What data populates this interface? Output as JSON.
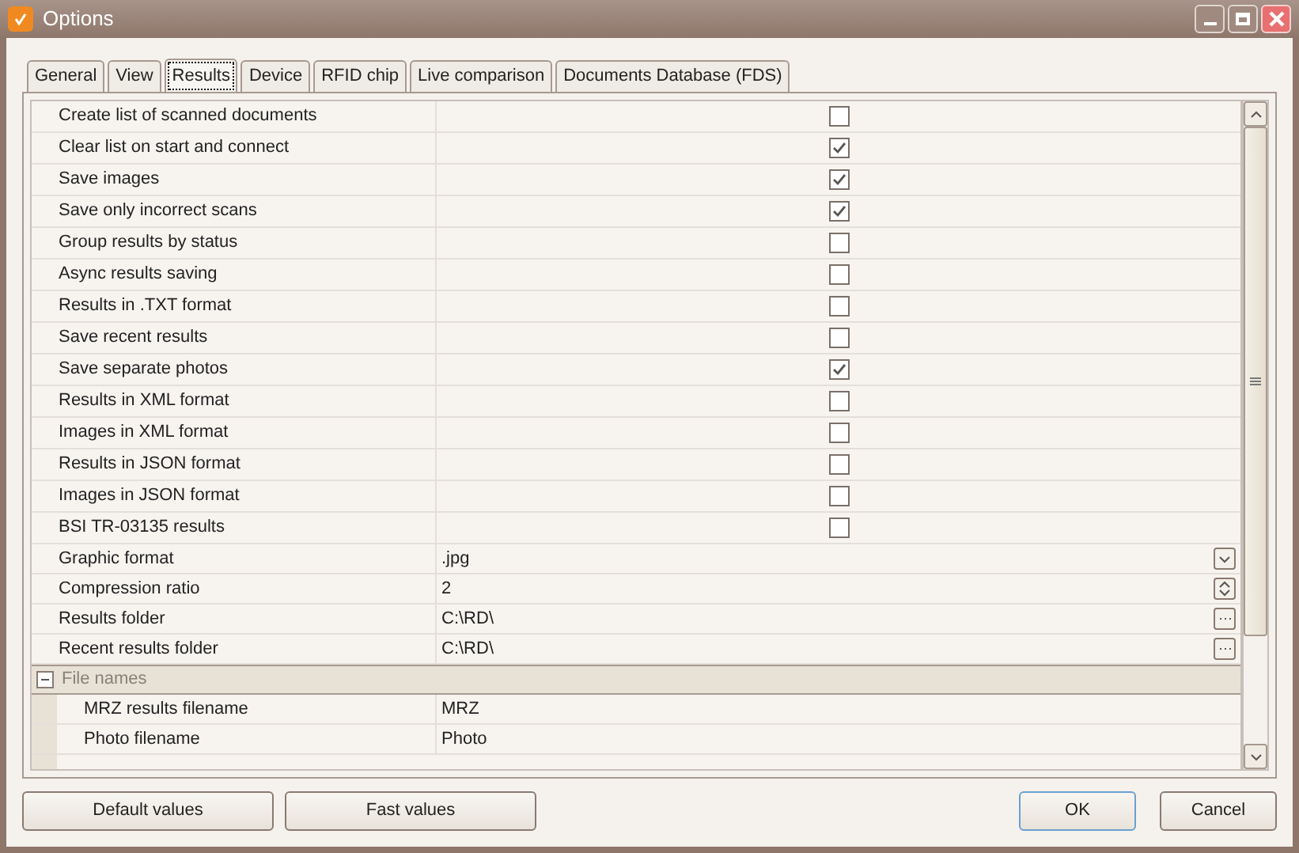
{
  "window": {
    "title": "Options"
  },
  "tabs": [
    {
      "label": "General",
      "selected": false
    },
    {
      "label": "View",
      "selected": false
    },
    {
      "label": "Results",
      "selected": true
    },
    {
      "label": "Device",
      "selected": false
    },
    {
      "label": "RFID chip",
      "selected": false
    },
    {
      "label": "Live comparison",
      "selected": false
    },
    {
      "label": "Documents Database (FDS)",
      "selected": false
    }
  ],
  "properties": [
    {
      "kind": "checkbox",
      "label": "Create list of scanned documents",
      "checked": false
    },
    {
      "kind": "checkbox",
      "label": "Clear list on start and connect",
      "checked": true
    },
    {
      "kind": "checkbox",
      "label": "Save images",
      "checked": true
    },
    {
      "kind": "checkbox",
      "label": "Save only incorrect scans",
      "checked": true
    },
    {
      "kind": "checkbox",
      "label": "Group results by status",
      "checked": false
    },
    {
      "kind": "checkbox",
      "label": "Async results saving",
      "checked": false
    },
    {
      "kind": "checkbox",
      "label": "Results in .TXT format",
      "checked": false
    },
    {
      "kind": "checkbox",
      "label": "Save recent results",
      "checked": false
    },
    {
      "kind": "checkbox",
      "label": "Save separate photos",
      "checked": true
    },
    {
      "kind": "checkbox",
      "label": "Results in XML format",
      "checked": false
    },
    {
      "kind": "checkbox",
      "label": "Images in XML format",
      "checked": false
    },
    {
      "kind": "checkbox",
      "label": "Results in JSON format",
      "checked": false
    },
    {
      "kind": "checkbox",
      "label": "Images in JSON format",
      "checked": false
    },
    {
      "kind": "checkbox",
      "label": "BSI TR-03135 results",
      "checked": false
    },
    {
      "kind": "dropdown",
      "label": "Graphic format",
      "value": ".jpg"
    },
    {
      "kind": "spin",
      "label": "Compression ratio",
      "value": "2"
    },
    {
      "kind": "browse",
      "label": "Results folder",
      "value": "C:\\RD\\"
    },
    {
      "kind": "browse",
      "label": "Recent results folder",
      "value": "C:\\RD\\"
    },
    {
      "kind": "group",
      "label": "File names",
      "expanded": true,
      "children": [
        {
          "label": "MRZ results filename",
          "value": "MRZ"
        },
        {
          "label": "Photo filename",
          "value": "Photo"
        }
      ]
    }
  ],
  "buttons": {
    "left": [
      "Default values",
      "Fast values"
    ],
    "right": [
      "OK",
      "Cancel"
    ]
  }
}
